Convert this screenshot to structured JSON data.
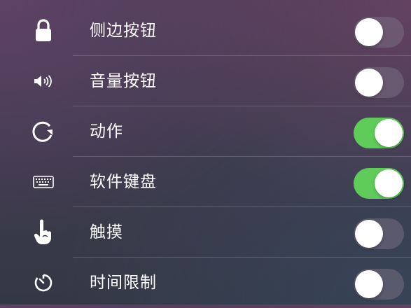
{
  "settings": [
    {
      "label": "侧边按钮",
      "icon": "lock-icon",
      "enabled": false
    },
    {
      "label": "音量按钮",
      "icon": "speaker-volume-icon",
      "enabled": false
    },
    {
      "label": "动作",
      "icon": "rotate-icon",
      "enabled": true
    },
    {
      "label": "软件键盘",
      "icon": "keyboard-icon",
      "enabled": true
    },
    {
      "label": "触摸",
      "icon": "touch-hand-icon",
      "enabled": false
    },
    {
      "label": "时间限制",
      "icon": "timer-icon",
      "enabled": false
    }
  ],
  "colors": {
    "toggle_on": "#5fcc5a",
    "toggle_off": "rgba(120,110,130,0.55)",
    "knob": "#ffffff",
    "text": "#ffffff"
  }
}
